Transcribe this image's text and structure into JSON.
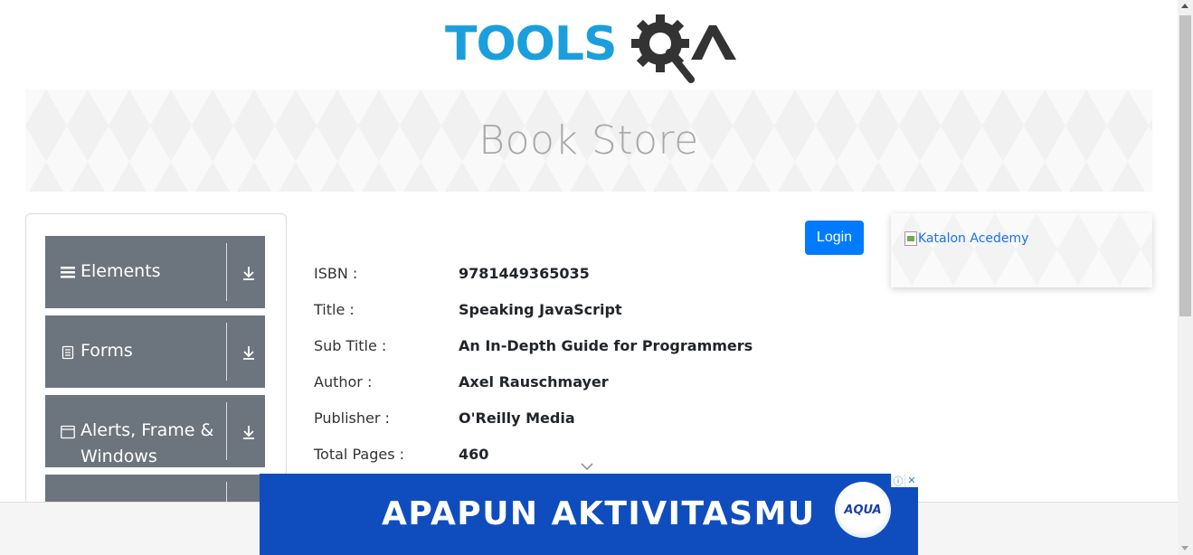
{
  "brand": {
    "logo_text_1": "TOOLS",
    "logo_text_2": "QA",
    "primary": "#1b9fdc",
    "dark": "#333333"
  },
  "banner": {
    "title": "Book Store"
  },
  "sidebar": {
    "groups": [
      {
        "label": "Elements",
        "icon": "hamburger-icon"
      },
      {
        "label": "Forms",
        "icon": "document-icon"
      },
      {
        "label_line1": "Alerts, Frame &",
        "label_line2": "Windows",
        "icon": "window-icon"
      },
      {
        "label": "",
        "icon": ""
      }
    ]
  },
  "login": {
    "label": "Login",
    "color": "#007bff"
  },
  "book": {
    "rows": [
      {
        "label": "ISBN :",
        "value": "9781449365035"
      },
      {
        "label": "Title :",
        "value": "Speaking JavaScript"
      },
      {
        "label": "Sub Title :",
        "value": "An In-Depth Guide for Programmers"
      },
      {
        "label": "Author :",
        "value": "Axel Rauschmayer"
      },
      {
        "label": "Publisher :",
        "value": "O'Reilly Media"
      },
      {
        "label": "Total Pages :",
        "value": "460"
      }
    ]
  },
  "side_ad": {
    "alt_text": "Katalon Acedemy"
  },
  "bottom_ad": {
    "text": "APAPUN AKTIVITASMU",
    "brand": "AQUA",
    "background": "#0f4dbf",
    "info_icon": "ⓘ",
    "close_icon": "✕"
  }
}
